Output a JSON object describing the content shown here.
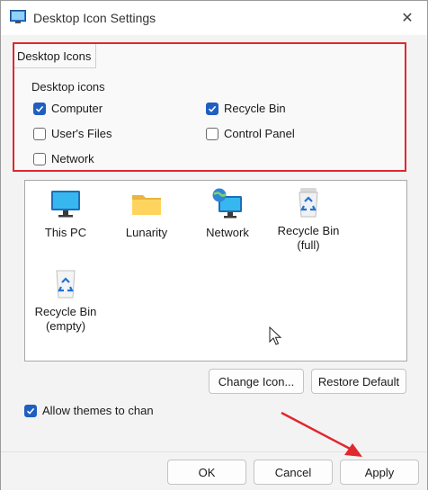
{
  "window": {
    "title": "Desktop Icon Settings",
    "close_glyph": "✕"
  },
  "tab": {
    "label": "Desktop Icons"
  },
  "group": {
    "label": "Desktop icons",
    "checkboxes": [
      {
        "label": "Computer",
        "checked": true
      },
      {
        "label": "Recycle Bin",
        "checked": true
      },
      {
        "label": "User's Files",
        "checked": false
      },
      {
        "label": "Control Panel",
        "checked": false
      },
      {
        "label": "Network",
        "checked": false
      }
    ]
  },
  "icons": [
    {
      "label": "This PC",
      "icon": "monitor-icon"
    },
    {
      "label": "Lunarity",
      "icon": "folder-icon"
    },
    {
      "label": "Network",
      "icon": "network-globe-icon"
    },
    {
      "label": "Recycle Bin (full)",
      "line1": "Recycle Bin",
      "line2": "(full)",
      "icon": "recycle-bin-full-icon"
    },
    {
      "label": "Recycle Bin (empty)",
      "line1": "Recycle Bin",
      "line2": "(empty)",
      "icon": "recycle-bin-empty-icon"
    }
  ],
  "buttons": {
    "change_icon": "Change Icon...",
    "restore_default": "Restore Default",
    "ok": "OK",
    "cancel": "Cancel",
    "apply": "Apply"
  },
  "themes_checkbox": {
    "label": "Allow themes to chan",
    "checked": true
  },
  "colors": {
    "accent": "#1f5fbf",
    "highlight_border": "#e0282e",
    "annotation_arrow": "#e0282e"
  }
}
